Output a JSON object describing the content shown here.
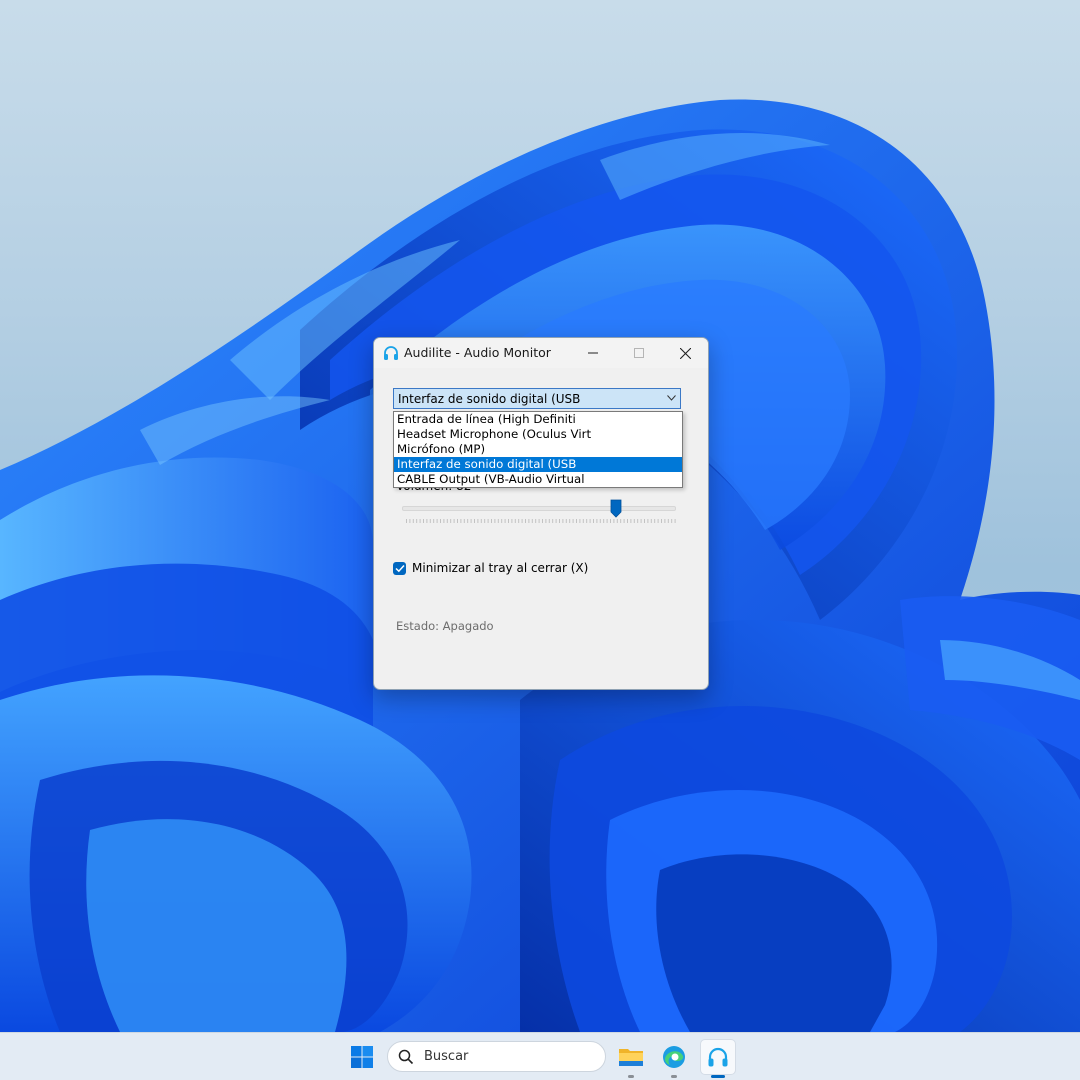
{
  "window": {
    "title": "Audilite - Audio Monitor",
    "app_icon": "headphones-icon"
  },
  "device_select": {
    "selected": "Interfaz de sonido digital (USB",
    "options": [
      "Entrada de línea (High Definiti",
      "Headset Microphone (Oculus Virt",
      "Micrófono (MP)",
      "Interfaz de sonido digital (USB",
      "CABLE Output (VB-Audio Virtual"
    ],
    "highlighted_index": 3
  },
  "volume": {
    "label": "Volumen: 82",
    "value": 82
  },
  "minimize_option": {
    "label": "Minimizar al tray al cerrar (X)",
    "checked": true
  },
  "status": {
    "text": "Estado: Apagado"
  },
  "taskbar": {
    "search_placeholder": "Buscar",
    "apps": [
      "file-explorer-icon",
      "edge-icon",
      "audilite-headphones-icon"
    ]
  },
  "colors": {
    "accent": "#0067c0",
    "highlight": "#0078d7",
    "combo_bg": "#cce4f7"
  }
}
